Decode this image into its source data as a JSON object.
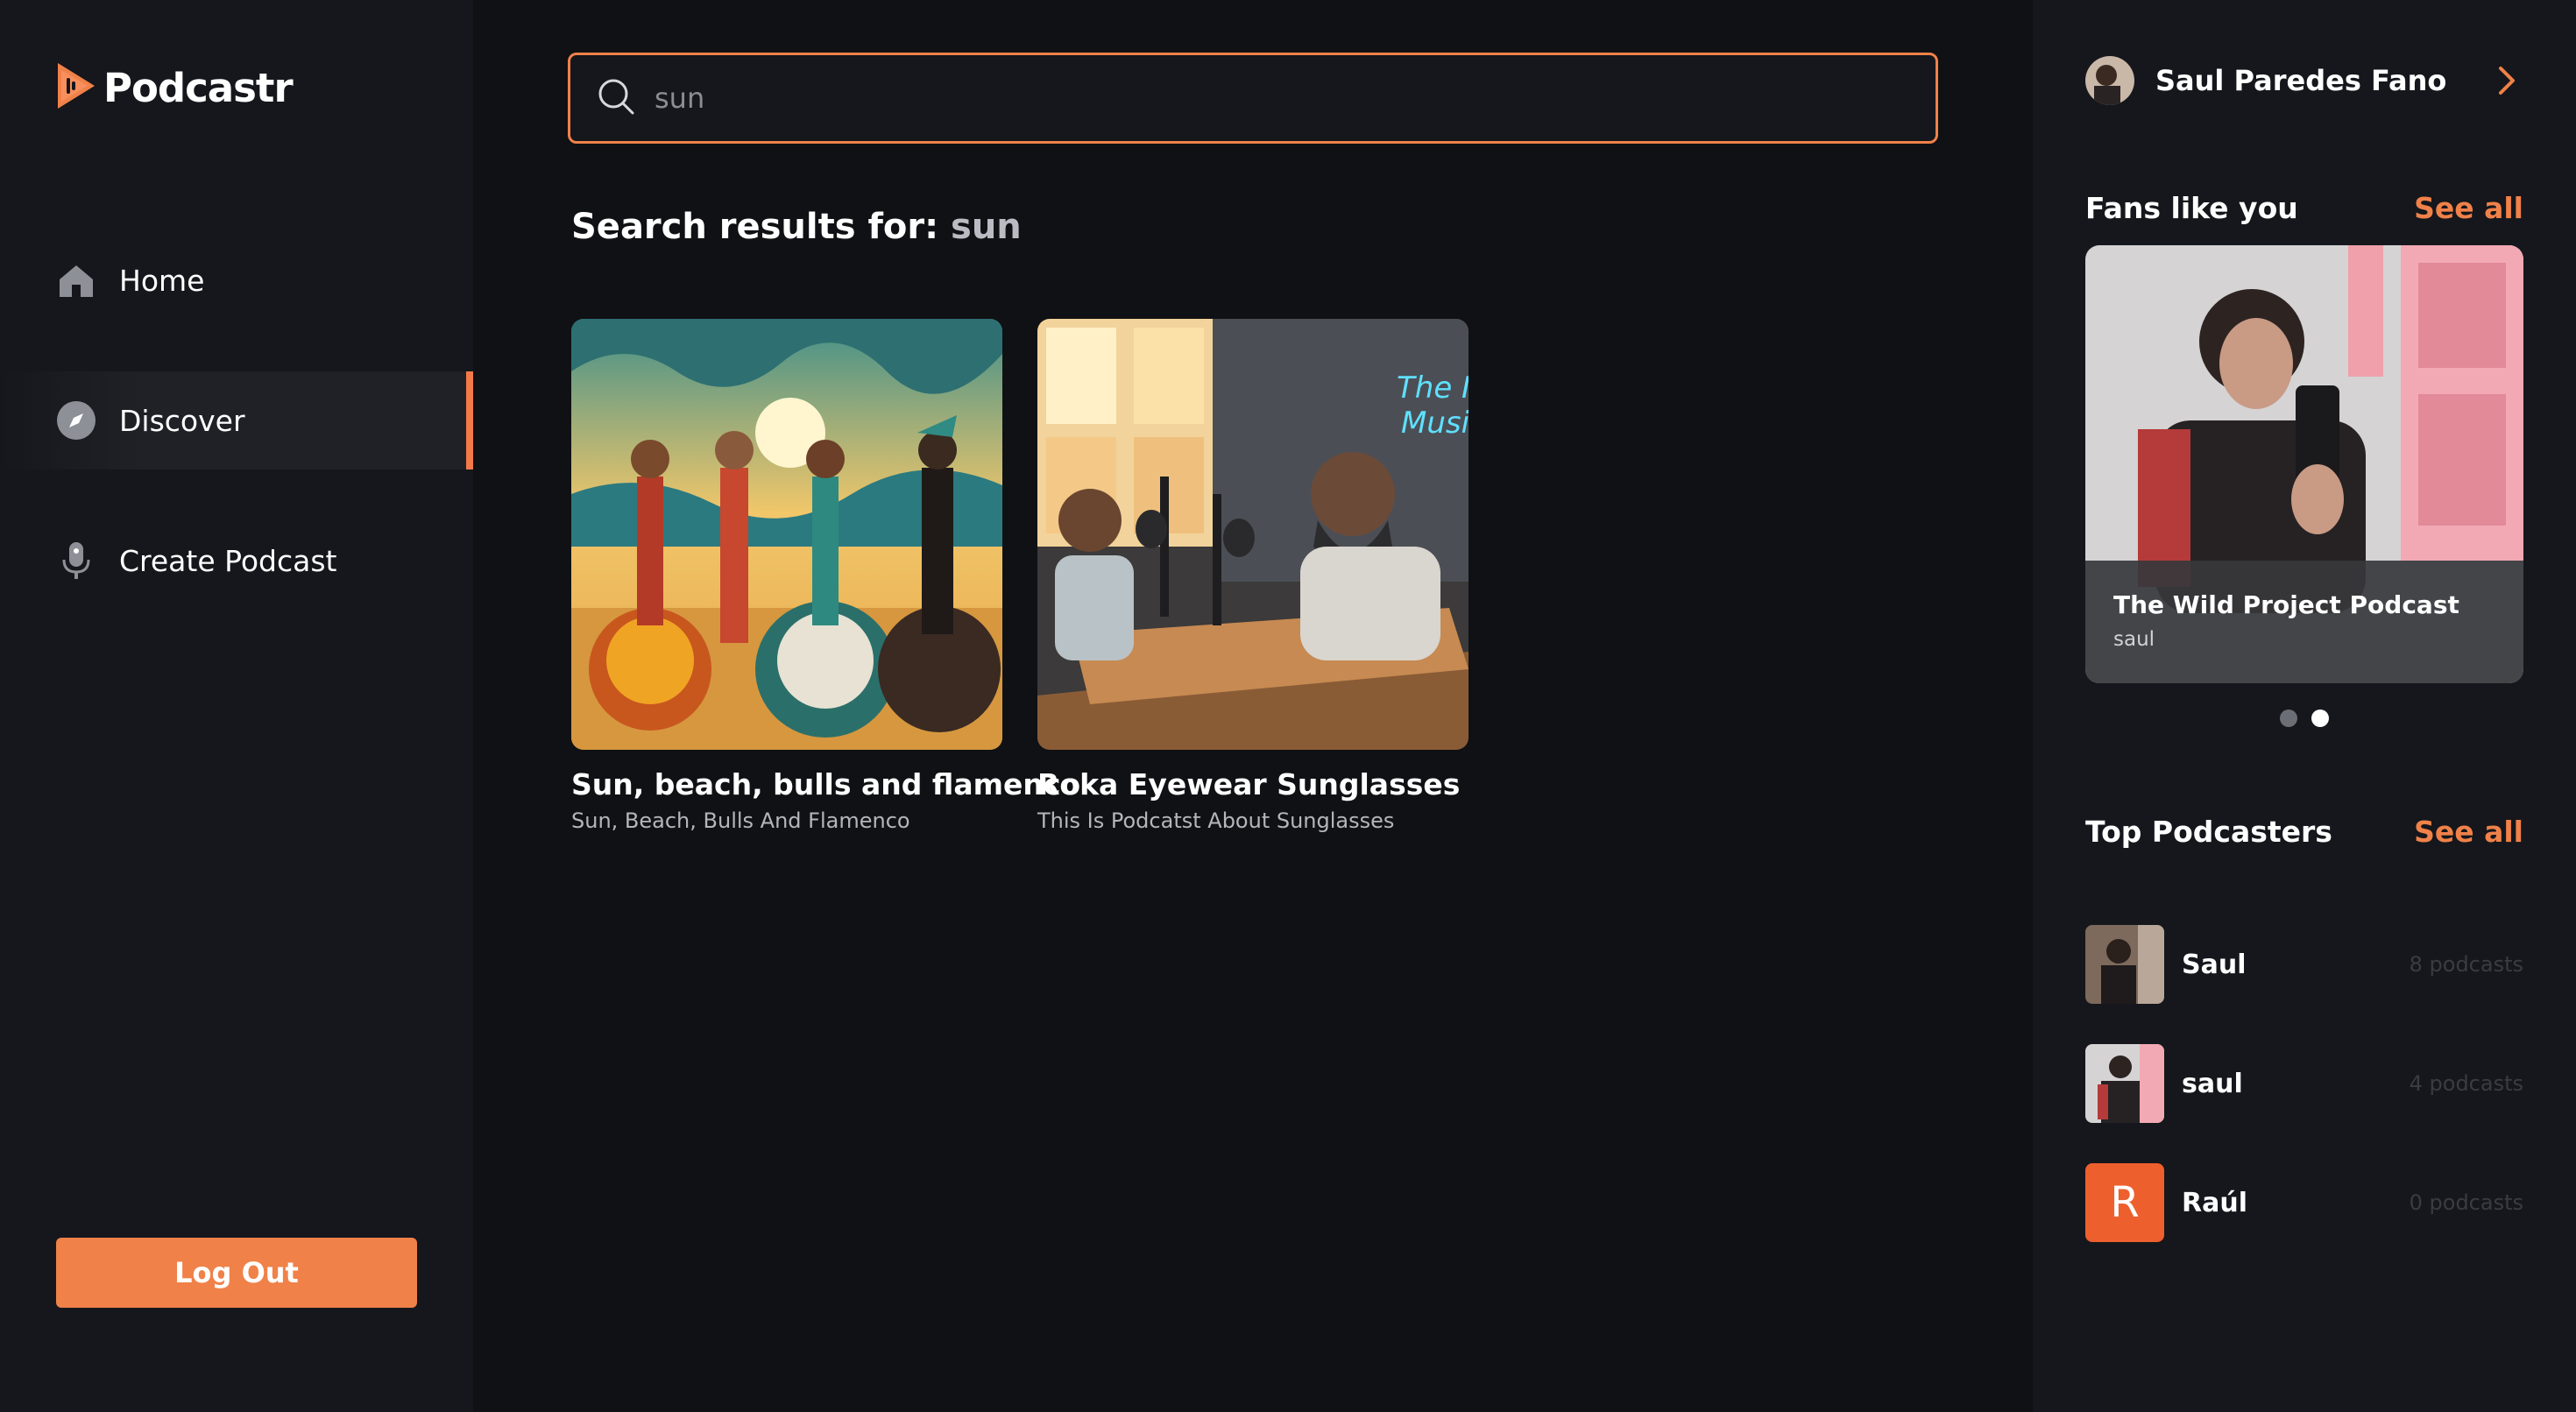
{
  "app": {
    "name": "Podcastr",
    "accent": "#f08149"
  },
  "sidebar": {
    "items": [
      {
        "label": "Home",
        "icon": "home-icon",
        "active": false
      },
      {
        "label": "Discover",
        "icon": "compass-icon",
        "active": true
      },
      {
        "label": "Create Podcast",
        "icon": "microphone-icon",
        "active": false
      }
    ],
    "logout_label": "Log Out"
  },
  "search": {
    "value": "sun",
    "icon": "search-icon"
  },
  "results": {
    "heading_prefix": "Search results for: ",
    "query": "sun",
    "cards": [
      {
        "title": "Sun, beach, bulls and flamenco",
        "description": "Sun, Beach, Bulls And Flamenco"
      },
      {
        "title": "Roka Eyewear Sunglasses",
        "description": "This Is Podcatst About Sunglasses"
      }
    ]
  },
  "right": {
    "user_name": "Saul Paredes Fano",
    "fans": {
      "title": "Fans like you",
      "see_all": "See all",
      "card_title": "The Wild Project Podcast",
      "card_author": "saul",
      "active_slide": 2,
      "total_slides": 2
    },
    "top": {
      "title": "Top Podcasters",
      "see_all": "See all",
      "podcasters": [
        {
          "name": "Saul",
          "count": "8 podcasts"
        },
        {
          "name": "saul",
          "count": "4 podcasts"
        },
        {
          "name": "Raúl",
          "count": "0 podcasts",
          "initial": "R"
        }
      ]
    }
  }
}
